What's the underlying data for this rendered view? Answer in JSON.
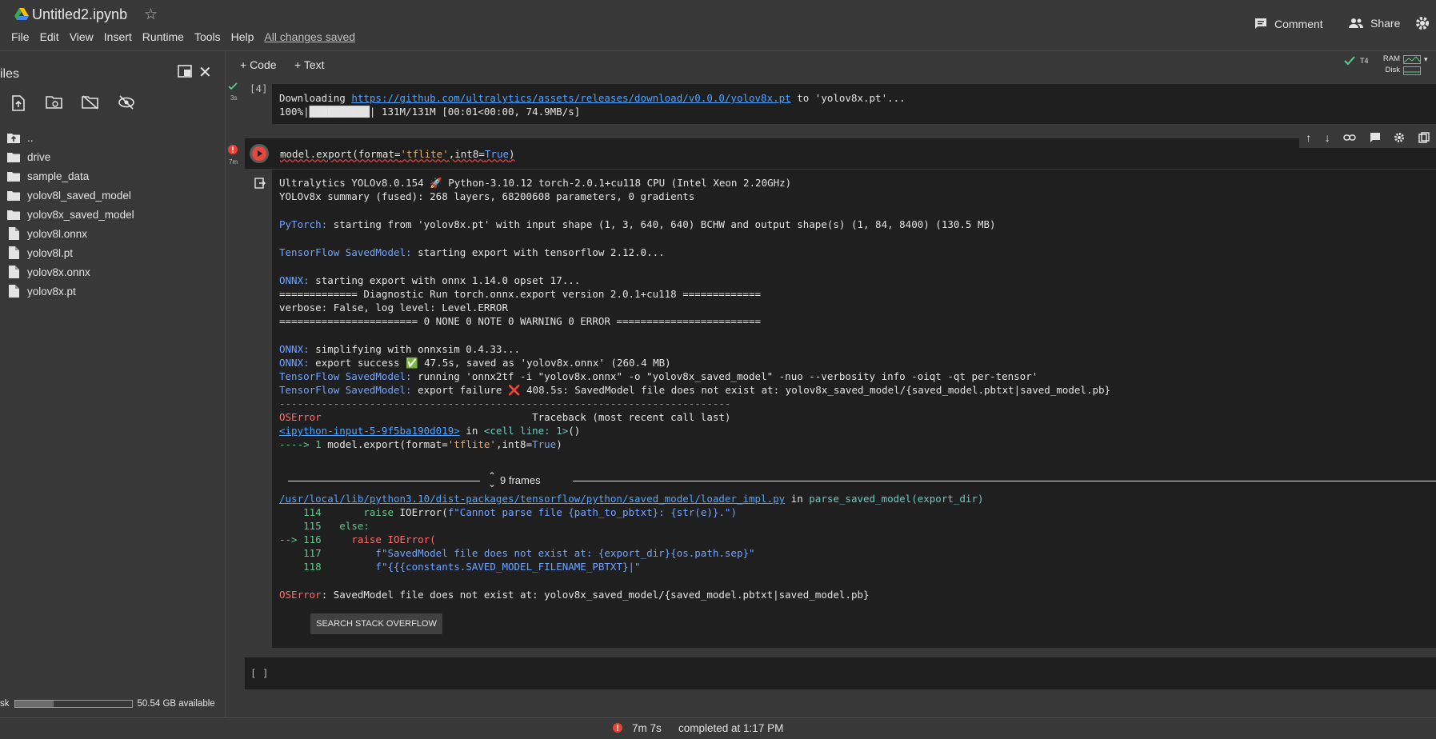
{
  "header": {
    "title": "Untitled2.ipynb",
    "menu": [
      "File",
      "Edit",
      "View",
      "Insert",
      "Runtime",
      "Tools",
      "Help"
    ],
    "saved_status": "All changes saved",
    "comment": "Comment",
    "share": "Share"
  },
  "sidebar": {
    "title": "iles",
    "files": [
      {
        "name": "..",
        "type": "up"
      },
      {
        "name": "drive",
        "type": "folder"
      },
      {
        "name": "sample_data",
        "type": "folder"
      },
      {
        "name": "yolov8l_saved_model",
        "type": "folder"
      },
      {
        "name": "yolov8x_saved_model",
        "type": "folder"
      },
      {
        "name": "yolov8l.onnx",
        "type": "file"
      },
      {
        "name": "yolov8l.pt",
        "type": "file"
      },
      {
        "name": "yolov8x.onnx",
        "type": "file"
      },
      {
        "name": "yolov8x.pt",
        "type": "file"
      }
    ],
    "disk_label": "sk",
    "disk_available": "50.54 GB available",
    "disk_used_fraction": 0.33
  },
  "toolbar": {
    "add_code": "+ Code",
    "add_text": "+ Text",
    "runtime": "T4",
    "ram": "RAM",
    "disk": "Disk"
  },
  "cells": {
    "prev": {
      "exec_count": "[4]",
      "duration": "3s",
      "line1_prefix": "Downloading ",
      "line1_link": "https://github.com/ultralytics/assets/releases/download/v0.0.0/yolov8x.pt",
      "line1_suffix": " to 'yolov8x.pt'...",
      "line2": "100%|██████████| 131M/131M [00:01<00:00, 74.9MB/s]"
    },
    "current": {
      "duration": "7m",
      "code_a": "model.export(format=",
      "code_b": "'tflite'",
      "code_c": ",int8=",
      "code_d": "True",
      "code_e": ")"
    },
    "output": {
      "l1": "Ultralytics YOLOv8.0.154 🚀 Python-3.10.12 torch-2.0.1+cu118 CPU (Intel Xeon 2.20GHz)",
      "l2": "YOLOv8x summary (fused): 268 layers, 68200608 parameters, 0 gradients",
      "pytorch_label": "PyTorch:",
      "pytorch_text": " starting from 'yolov8x.pt' with input shape (1, 3, 640, 640) BCHW and output shape(s) (1, 84, 8400) (130.5 MB)",
      "tf_label": "TensorFlow SavedModel:",
      "tf_text1": " starting export with tensorflow 2.12.0...",
      "onnx_label": "ONNX:",
      "onnx_text1": " starting export with onnx 1.14.0 opset 17...",
      "diag1": "============= Diagnostic Run torch.onnx.export version 2.0.1+cu118 =============",
      "verbose": "verbose: False, log level: Level.ERROR",
      "diag2": "======================= 0 NONE 0 NOTE 0 WARNING 0 ERROR ========================",
      "onnx_text2": " simplifying with onnxsim 0.4.33...",
      "onnx_text3": " export success ✅ 47.5s, saved as 'yolov8x.onnx' (260.4 MB)",
      "tf_text2": " running 'onnx2tf -i \"yolov8x.onnx\" -o \"yolov8x_saved_model\" -nuo --verbosity info -oiqt -qt per-tensor'",
      "tf_text3": " export failure ❌ 408.5s: SavedModel file does not exist at: yolov8x_saved_model/{saved_model.pbtxt|saved_model.pb}",
      "dashes": "---------------------------------------------------------------------------",
      "oserror": "OSError",
      "traceback": "                                   Traceback (most recent call last)",
      "ipy_link": "<ipython-input-5-9f5ba190d019>",
      "ipy_mid": " in ",
      "ipy_cell": "<cell line: 1>",
      "ipy_end": "()",
      "arrow1": "----> 1 ",
      "arrow1_code_a": "model.export(format=",
      "arrow1_code_b": "'tflite'",
      "arrow1_code_c": ",int8=",
      "arrow1_code_d": "True",
      "arrow1_code_e": ")",
      "frames": "9 frames",
      "path_link": "/usr/local/lib/python3.10/dist-packages/tensorflow/python/saved_model/loader_impl.py",
      "path_mid": " in ",
      "path_fn": "parse_saved_model(export_dir)",
      "t114_num": "    114 ",
      "t114_code_a": "      raise ",
      "t114_code_b": "IOError(",
      "t114_code_c": "f\"Cannot parse file {path_to_pbtxt}: {str(e)}.\")",
      "t115_num": "    115 ",
      "t115_code": "  else:",
      "t116_arrow": "--> 116 ",
      "t116_code": "    raise IOError(",
      "t117_num": "    117 ",
      "t117_code": "        f\"SavedModel file does not exist at: {export_dir}{os.path.sep}\"",
      "t118_num": "    118 ",
      "t118_code": "        f\"{{{constants.SAVED_MODEL_FILENAME_PBTXT}|\"",
      "final_err_label": "OSError",
      "final_err_text": ": SavedModel file does not exist at: yolov8x_saved_model/{saved_model.pbtxt|saved_model.pb}",
      "so_button": "SEARCH STACK OVERFLOW"
    },
    "empty": {
      "exec_count": "[ ]"
    }
  },
  "footer": {
    "duration": "7m 7s",
    "completed": "completed at 1:17 PM"
  }
}
